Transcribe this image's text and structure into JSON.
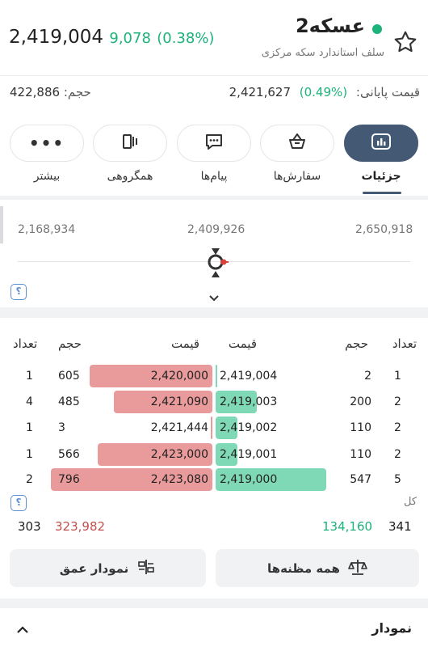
{
  "header": {
    "symbol": "عسکه2",
    "subtitle": "سلف استاندارد سکه مرکزی",
    "last_price": "2,419,004",
    "change": "9,078",
    "change_pct": "(0.38%)",
    "closing_label": "قیمت پایانی:",
    "closing_pct": "(0.49%)",
    "closing_price": "2,421,627",
    "volume_label": "حجم:",
    "volume": "422,886",
    "status_color": "#1bb37a",
    "up_color": "#1bb37a",
    "down_color": "#c0504d"
  },
  "tabs": [
    {
      "label": "جزئیات",
      "icon": "chart-icon",
      "active": true
    },
    {
      "label": "سفارش‌ها",
      "icon": "basket-icon",
      "active": false
    },
    {
      "label": "پیام‌ها",
      "icon": "chat-icon",
      "active": false
    },
    {
      "label": "همگروهی",
      "icon": "compare-icon",
      "active": false
    },
    {
      "label": "بیشتر",
      "icon": "more-icon",
      "active": false
    }
  ],
  "range": {
    "low": "2,168,934",
    "mid": "2,409,926",
    "high": "2,650,918",
    "help": "؟"
  },
  "orderbook": {
    "headers": {
      "count_buy": "تعداد",
      "vol_buy": "حجم",
      "price_buy": "قیمت",
      "price_sell": "قیمت",
      "vol_sell": "حجم",
      "count_sell": "تعداد"
    },
    "rows": [
      {
        "bid_count": "1",
        "bid_vol": "2",
        "bid_price": "2,419,004",
        "ask_price": "2,420,000",
        "ask_vol": "605",
        "ask_count": "1",
        "bid_frac": 0.004,
        "ask_frac": 0.76
      },
      {
        "bid_count": "2",
        "bid_vol": "200",
        "bid_price": "2,419,003",
        "ask_price": "2,421,090",
        "ask_vol": "485",
        "ask_count": "4",
        "bid_frac": 0.37,
        "ask_frac": 0.61
      },
      {
        "bid_count": "2",
        "bid_vol": "110",
        "bid_price": "2,419,002",
        "ask_price": "2,421,444",
        "ask_vol": "3",
        "ask_count": "1",
        "bid_frac": 0.2,
        "ask_frac": 0.004
      },
      {
        "bid_count": "2",
        "bid_vol": "110",
        "bid_price": "2,419,001",
        "ask_price": "2,423,000",
        "ask_vol": "566",
        "ask_count": "1",
        "bid_frac": 0.2,
        "ask_frac": 0.71
      },
      {
        "bid_count": "5",
        "bid_vol": "547",
        "bid_price": "2,419,000",
        "ask_price": "2,423,080",
        "ask_vol": "796",
        "ask_count": "2",
        "bid_frac": 1.0,
        "ask_frac": 1.0
      }
    ],
    "total_label": "کل",
    "total_bid_count": "341",
    "total_bid_vol": "134,160",
    "total_ask_vol": "323,982",
    "total_ask_count": "303",
    "help": "؟"
  },
  "buttons": {
    "all_suspects": "همه مظنه‌ها",
    "depth_chart": "نمودار عمق"
  },
  "chart_section": {
    "title": "نمودار"
  }
}
